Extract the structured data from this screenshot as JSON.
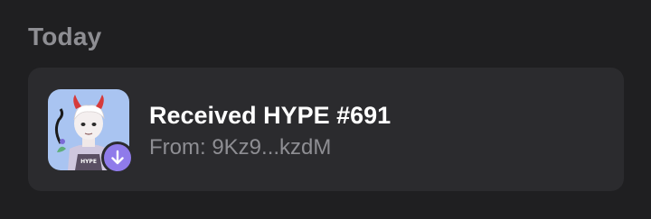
{
  "section": {
    "title": "Today"
  },
  "activity": {
    "title": "Received HYPE #691",
    "subtitle": "From: 9Kz9...kzdM",
    "thumbnail_icon": "nft-character-image",
    "badge_icon": "arrow-down-icon"
  },
  "colors": {
    "background": "#1f1f21",
    "card": "#2b2b2e",
    "accent_badge": "#8f7bea",
    "muted_text": "#8e8e93",
    "primary_text": "#ffffff"
  }
}
